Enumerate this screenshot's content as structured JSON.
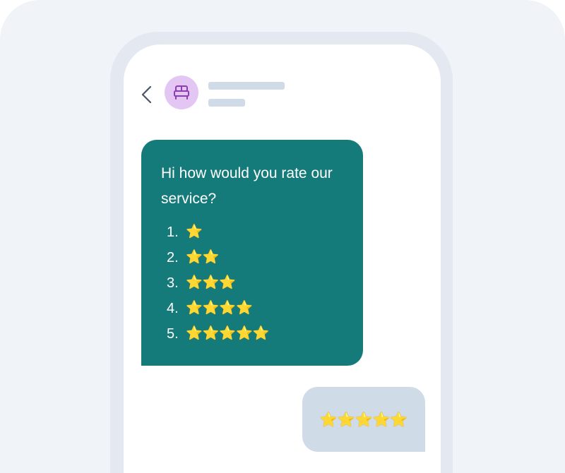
{
  "header": {
    "back_icon": "chevron-left-icon",
    "avatar_icon": "bed-icon",
    "avatar_color": "#e4c6f4"
  },
  "messages": {
    "incoming": {
      "text": "Hi how would you rate our service?",
      "options": [
        {
          "number": "1.",
          "stars": "⭐"
        },
        {
          "number": "2.",
          "stars": "⭐⭐"
        },
        {
          "number": "3.",
          "stars": "⭐⭐⭐"
        },
        {
          "number": "4.",
          "stars": "⭐⭐⭐⭐"
        },
        {
          "number": "5.",
          "stars": "⭐⭐⭐⭐⭐"
        }
      ],
      "bubble_color": "#157b7a"
    },
    "outgoing": {
      "text": "⭐⭐⭐⭐⭐",
      "bubble_color": "#d0dbe8"
    }
  }
}
